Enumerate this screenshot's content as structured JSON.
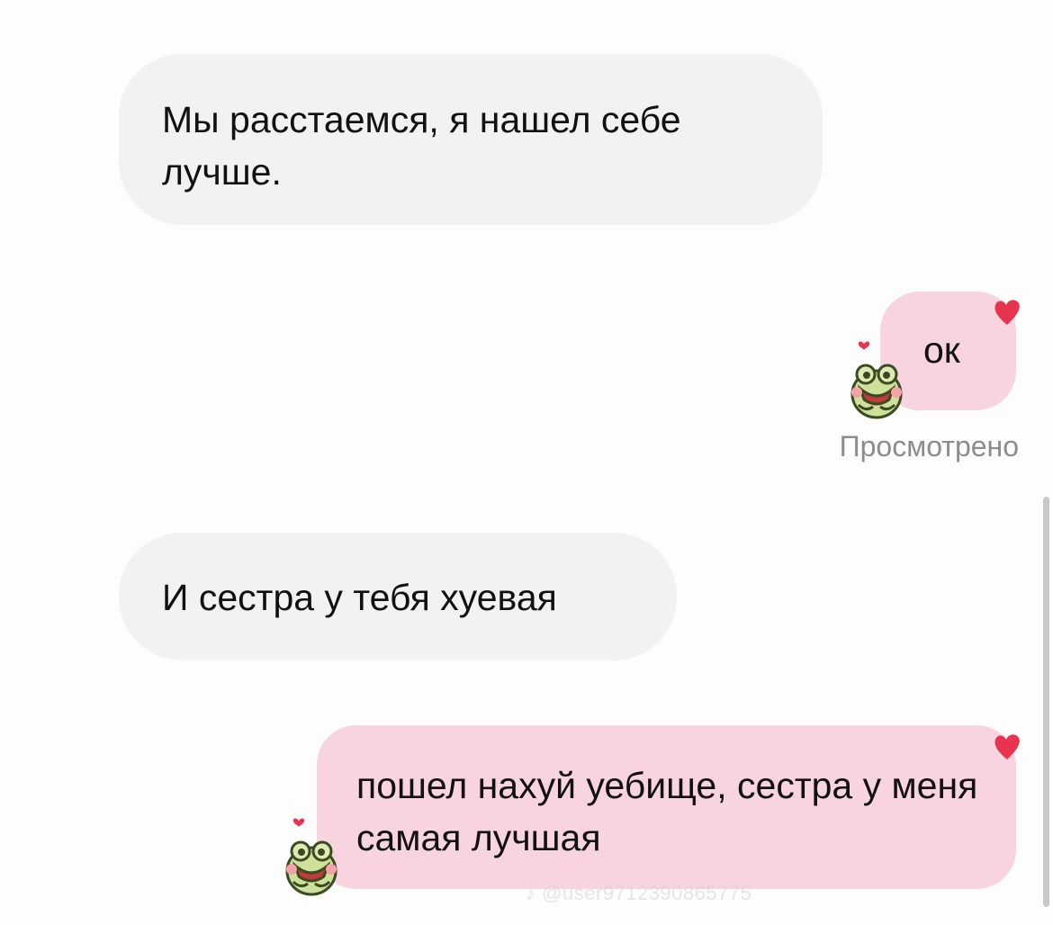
{
  "messages": [
    {
      "side": "incoming",
      "text": "Мы расстаемся, я нашел себе лучше."
    },
    {
      "side": "outgoing",
      "text": "ок",
      "reaction": "heart"
    },
    {
      "side": "incoming",
      "text": "И сестра у тебя хуевая"
    },
    {
      "side": "outgoing",
      "text": "пошел нахуй уебище, сестра у меня самая лучшая",
      "reaction": "heart"
    }
  ],
  "read_status": "Просмотрено",
  "watermark": "@user9712390865775",
  "colors": {
    "incoming_bubble": "#f2f2f2",
    "outgoing_bubble": "#f8d3e0",
    "heart": "#e8344e",
    "read_status": "#8c8c8c"
  },
  "icons": [
    "heart-reaction-icon",
    "frog-love-sticker-icon",
    "tiktok-logo-icon"
  ]
}
